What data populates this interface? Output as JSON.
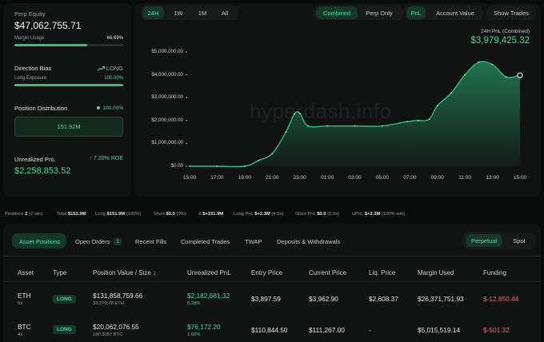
{
  "left": {
    "equity_label": "Perp Equity",
    "equity_value": "$47,062,755.71",
    "margin_label": "Margin Usage",
    "margin_value": "66.69%",
    "margin_fraction": 0.6669,
    "bias_label": "Direction Bias",
    "bias_value": "LONG",
    "long_exposure_label": "Long Exposure",
    "long_exposure_value": "100.00%",
    "long_exposure_fraction": 1.0,
    "distribution_label": "Position Distribution",
    "distribution_value": "100.00%",
    "distribution_amount": "151.92M",
    "upnl_label": "Unrealized PnL",
    "roe_value": "7.20% ROE",
    "upnl_value": "$2,258,853.52"
  },
  "timeframes": [
    "24H",
    "1W",
    "1M",
    "All"
  ],
  "timeframe_active": "24H",
  "mode_tabs": [
    "Combined",
    "Perp Only"
  ],
  "mode_active": "Combined",
  "metric_tabs": [
    "PnL",
    "Account Value"
  ],
  "metric_active": "PnL",
  "show_trades_label": "Show Trades",
  "chart_header": {
    "label": "24H PnL (Combined)",
    "value": "$3,979,425.32"
  },
  "watermark": "hyperdash.info",
  "chart_data": {
    "type": "area",
    "x_ticks": [
      "15:00",
      "17:00",
      "19:00",
      "21:00",
      "23:00",
      "01:00",
      "03:00",
      "05:00",
      "07:00",
      "09:00",
      "11:00",
      "13:00",
      "15:00"
    ],
    "y_ticks": [
      "$5,000,000.00",
      "$4,000,000.00",
      "$3,000,000.00",
      "$2,000,000.00",
      "$1,000,000.00",
      "$0.00"
    ],
    "ylim": [
      0,
      5000000
    ],
    "x_hours": [
      0,
      2,
      4,
      5,
      6,
      7,
      7.6,
      8,
      8.6,
      10,
      12,
      14,
      15.8,
      16.6,
      17.4,
      18,
      19,
      20,
      21,
      22,
      23,
      24
    ],
    "values": [
      0,
      0,
      0,
      250000,
      550000,
      1500000,
      2280000,
      2320000,
      1760000,
      1760000,
      1760000,
      1760000,
      1950000,
      2000000,
      2050000,
      2650000,
      3200000,
      4000000,
      4550000,
      4450000,
      3900000,
      3979425
    ],
    "color": "#2fbf80",
    "grid": false
  },
  "stats": {
    "positions_label": "Positions",
    "positions_count": "2",
    "positions_note": "(2 win)",
    "total_label": "Total",
    "total_value": "$151.9M",
    "long_label": "Long",
    "long_value": "$151.9M",
    "long_pct": "(100%)",
    "short_label": "Short",
    "short_value": "$0.0",
    "short_pct": "(0%)",
    "delta_label": "Δ",
    "delta_value": "$+151.9M",
    "long_pnl_label": "Long PnL",
    "long_pnl_value": "$+2.3M",
    "long_pnl_x": "(4.5x)",
    "short_pnl_label": "Short PnL",
    "short_pnl_value": "$0.0",
    "short_pnl_x": "(0.0x)",
    "upnl_label": "UPnL",
    "upnl_value": "$+2.3M",
    "upnl_pct": "(100% win)"
  },
  "tabs": [
    {
      "label": "Asset Positions"
    },
    {
      "label": "Open Orders",
      "badge": "1"
    },
    {
      "label": "Recent Fills"
    },
    {
      "label": "Completed Trades"
    },
    {
      "label": "TWAP"
    },
    {
      "label": "Deposits & Withdrawals"
    }
  ],
  "tab_active": "Asset Positions",
  "market_tabs": [
    "Perpetual",
    "Spot"
  ],
  "market_active": "Perpetual",
  "table": {
    "headers": [
      "Asset",
      "Type",
      "Position Value / Size",
      "Unrealized PnL",
      "Entry Price",
      "Current Price",
      "Liq. Price",
      "Margin Used",
      "Funding"
    ],
    "rows": [
      {
        "asset": "ETH",
        "leverage": "5x",
        "type": "LONG",
        "value": "$131,858,759.66",
        "size": "33,270.78 ETH",
        "upnl": "$2,182,681.32",
        "upnl_pct": "0.28%",
        "entry": "$3,897.59",
        "current": "$3,962.90",
        "liq": "$2,608.37",
        "margin": "$26,371,751.93",
        "funding": "$-12,850.44"
      },
      {
        "asset": "BTC",
        "leverage": "4x",
        "type": "LONG",
        "value": "$20,062,076.55",
        "size": "180.3057 BTC",
        "upnl": "$76,172.20",
        "upnl_pct": "1.02%",
        "entry": "$110,844.50",
        "current": "$111,267.00",
        "liq": "-",
        "margin": "$5,015,519.14",
        "funding": "$-501.32"
      }
    ]
  }
}
